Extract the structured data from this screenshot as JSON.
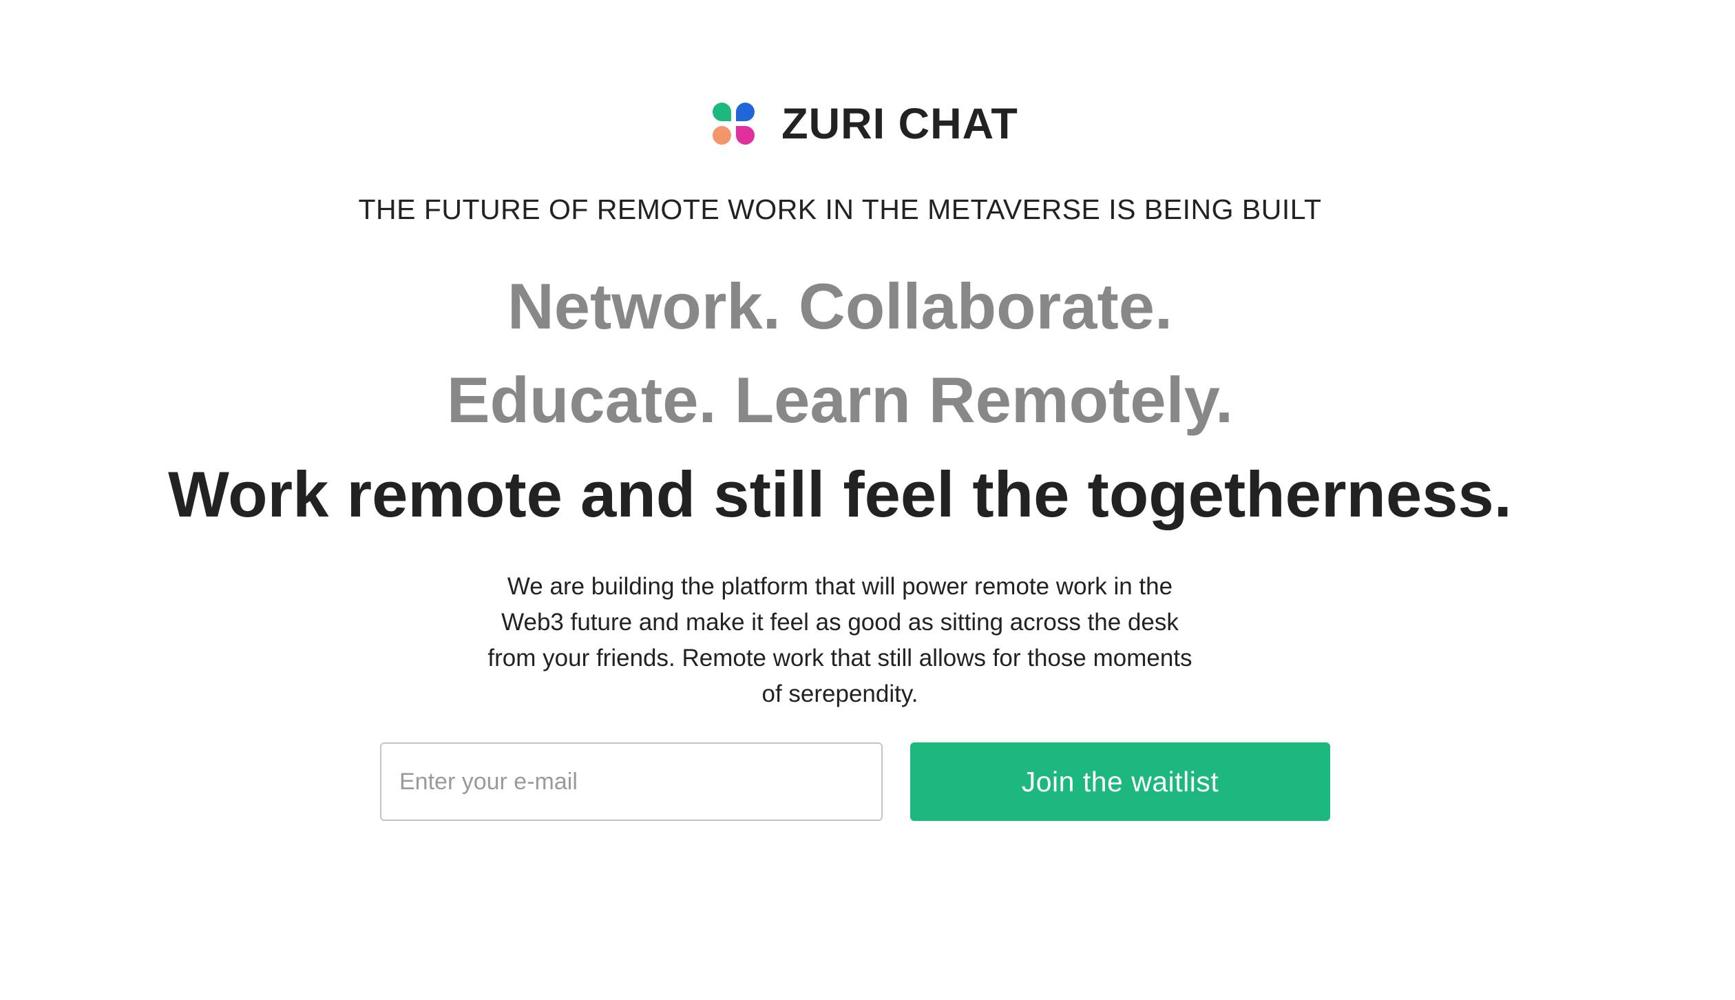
{
  "brand": {
    "name": "ZURI CHAT",
    "logo_icon": "four-dots-logo-icon",
    "logo_colors": [
      "#1db87e",
      "#2166d8",
      "#f3976b",
      "#e0309c"
    ]
  },
  "tagline": "THE FUTURE OF REMOTE WORK IN THE METAVERSE IS BEING BUILT",
  "headlines": {
    "line1": "Network. Collaborate.",
    "line2": "Educate. Learn Remotely.",
    "line3": "Work remote and still feel the togetherness."
  },
  "description": "We are building the platform that will power remote work in the Web3 future and make it feel as good as sitting across the desk from your friends. Remote work that still allows for those moments of serependity.",
  "signup": {
    "email_placeholder": "Enter your e-mail",
    "email_value": "",
    "button_label": "Join the waitlist"
  },
  "colors": {
    "accent": "#1db87e",
    "muted_heading": "#888888",
    "text": "#222222"
  }
}
